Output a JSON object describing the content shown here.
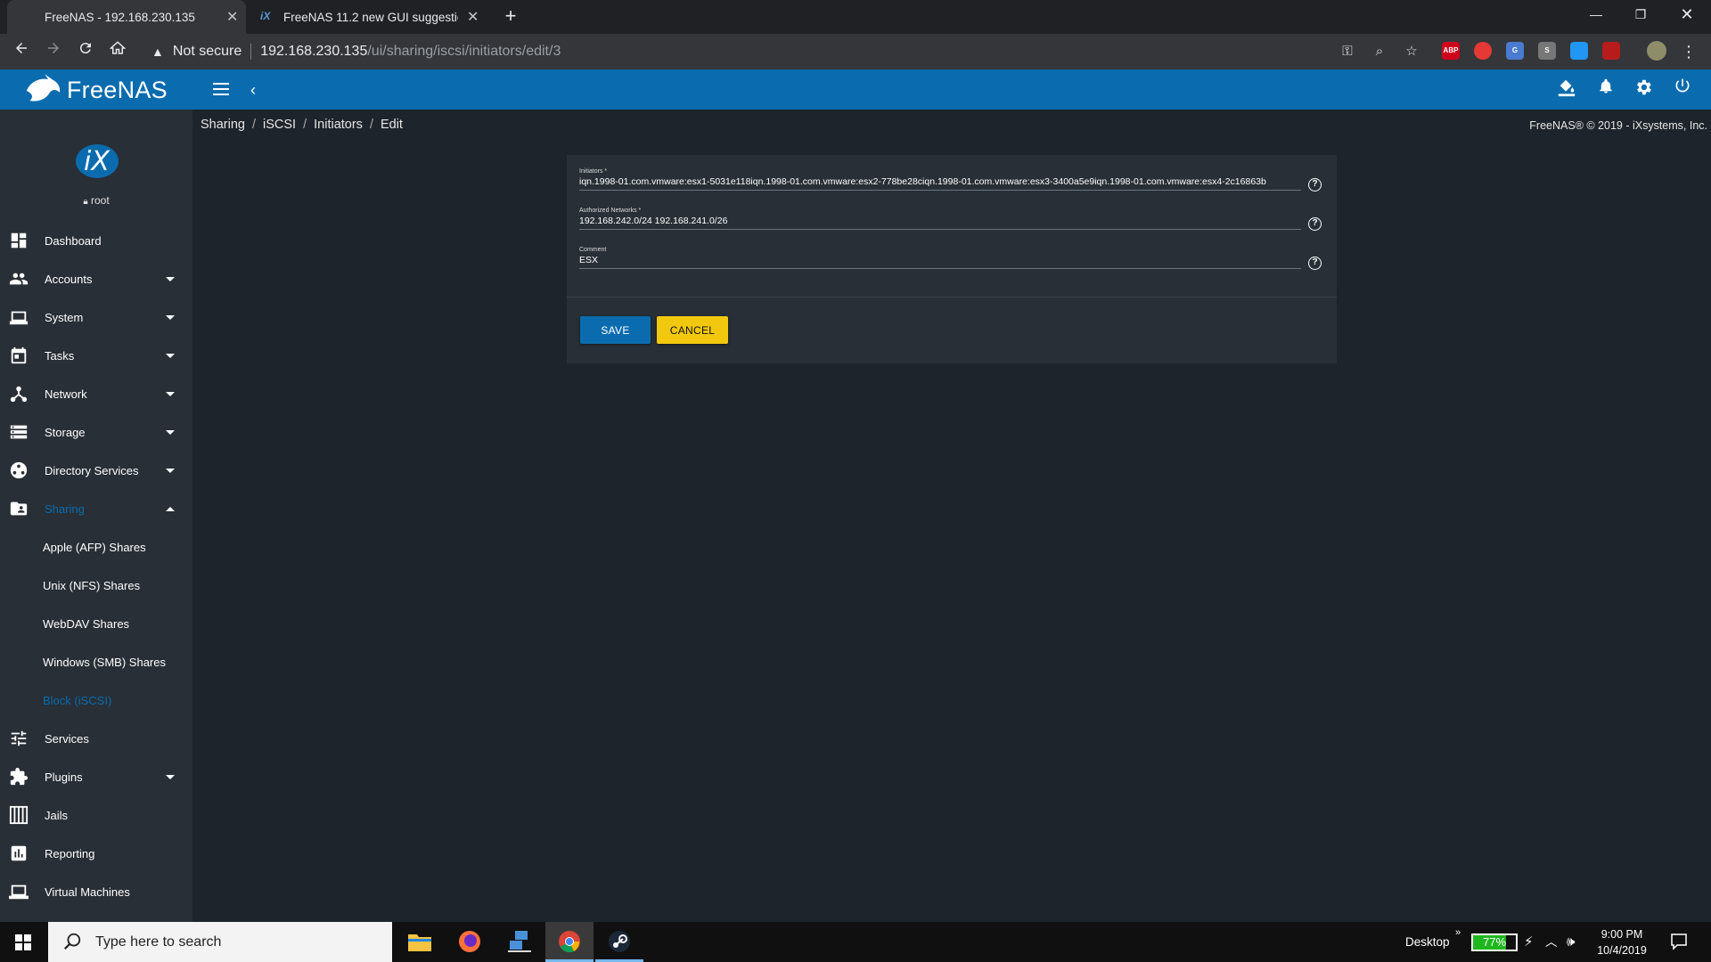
{
  "browser": {
    "tabs": [
      {
        "title": "FreeNAS - 192.168.230.135",
        "active": true
      },
      {
        "title": "FreeNAS 11.2 new GUI suggestio",
        "active": false
      }
    ],
    "security_label": "Not secure",
    "url_host": "192.168.230.135",
    "url_path": "/ui/sharing/iscsi/initiators/edit/3",
    "extensions": [
      "ABP",
      "",
      "G",
      "S",
      "",
      ""
    ]
  },
  "app": {
    "brand": "FreeNAS",
    "user": "root",
    "copyright": "FreeNAS® © 2019 - iXsystems, Inc.",
    "accent_color": "#0a6cae"
  },
  "breadcrumb": [
    "Sharing",
    "iSCSI",
    "Initiators",
    "Edit"
  ],
  "sidebar": {
    "items": [
      {
        "label": "Dashboard",
        "icon": "dashboard-icon",
        "expandable": false
      },
      {
        "label": "Accounts",
        "icon": "people-icon",
        "expandable": true
      },
      {
        "label": "System",
        "icon": "laptop-icon",
        "expandable": true
      },
      {
        "label": "Tasks",
        "icon": "calendar-icon",
        "expandable": true
      },
      {
        "label": "Network",
        "icon": "network-icon",
        "expandable": true
      },
      {
        "label": "Storage",
        "icon": "storage-icon",
        "expandable": true
      },
      {
        "label": "Directory Services",
        "icon": "directory-icon",
        "expandable": true
      },
      {
        "label": "Sharing",
        "icon": "folder-shared-icon",
        "expandable": true,
        "expanded": true,
        "active": true
      },
      {
        "label": "Services",
        "icon": "tune-icon",
        "expandable": false
      },
      {
        "label": "Plugins",
        "icon": "extension-icon",
        "expandable": true
      },
      {
        "label": "Jails",
        "icon": "jail-icon",
        "expandable": false
      },
      {
        "label": "Reporting",
        "icon": "chart-icon",
        "expandable": false
      },
      {
        "label": "Virtual Machines",
        "icon": "computer-icon",
        "expandable": false
      }
    ],
    "sharing_sub": [
      {
        "label": "Apple (AFP) Shares",
        "active": false
      },
      {
        "label": "Unix (NFS) Shares",
        "active": false
      },
      {
        "label": "WebDAV Shares",
        "active": false
      },
      {
        "label": "Windows (SMB) Shares",
        "active": false
      },
      {
        "label": "Block (iSCSI)",
        "active": true
      }
    ]
  },
  "form": {
    "initiators": {
      "label": "Initiators *",
      "value": "iqn.1998-01.com.vmware:esx1-5031e118iqn.1998-01.com.vmware:esx2-778be28ciqn.1998-01.com.vmware:esx3-3400a5e9iqn.1998-01.com.vmware:esx4-2c16863b"
    },
    "networks": {
      "label": "Authorized Networks *",
      "value": "192.168.242.0/24 192.168.241.0/26"
    },
    "comment": {
      "label": "Comment",
      "value": "ESX"
    },
    "save_label": "SAVE",
    "cancel_label": "CANCEL"
  },
  "taskbar": {
    "search_placeholder": "Type here to search",
    "desktop_label": "Desktop",
    "battery_percent": "77%",
    "battery_level": 0.77,
    "time": "9:00 PM",
    "date": "10/4/2019"
  }
}
